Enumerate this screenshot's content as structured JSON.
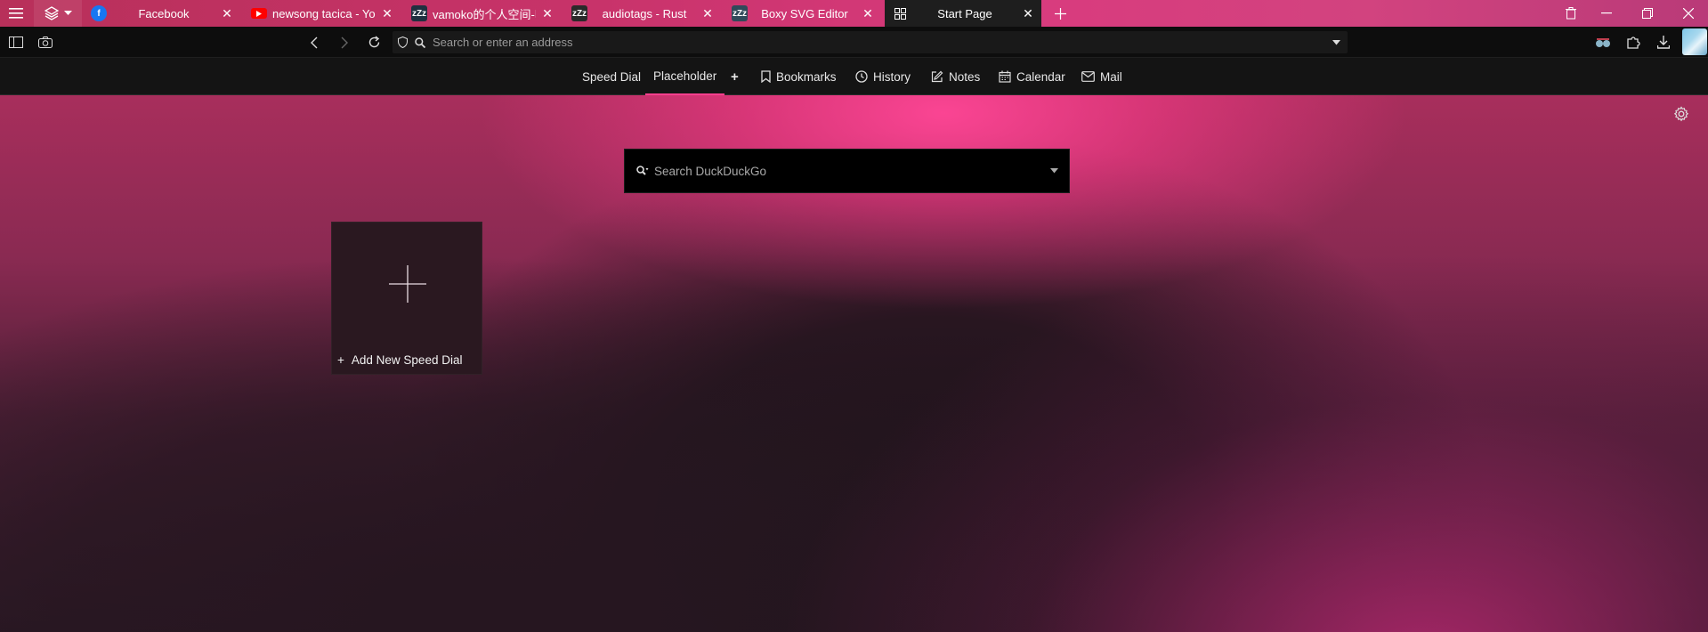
{
  "tabs": [
    {
      "title": "Facebook",
      "favicon": "facebook-icon",
      "favicon_color": "#1877f2",
      "close": "✕"
    },
    {
      "title": "newsong tacica - YouTube",
      "favicon": "youtube-icon",
      "favicon_color": "#ff0000",
      "close": "✕"
    },
    {
      "title": "vamoko的个人空间-哔哩哔哩",
      "favicon": "hibernated-tab-icon",
      "favicon_label": "zZz",
      "close": "✕"
    },
    {
      "title": "audiotags - Rust",
      "favicon": "hibernated-tab-icon",
      "favicon_label": "zZz",
      "close": "✕"
    },
    {
      "title": "Boxy SVG Editor",
      "favicon": "hibernated-tab-icon",
      "favicon_label": "zZz",
      "close": "✕"
    },
    {
      "title": "Start Page",
      "favicon": "speed-dial-grid-icon",
      "close": "✕",
      "active": true
    }
  ],
  "address_bar": {
    "placeholder": "Search or enter an address"
  },
  "start_nav": {
    "items": [
      {
        "label": "Speed Dial"
      },
      {
        "label": "Placeholder",
        "active": true
      },
      {
        "label": "+"
      },
      {
        "label": "Bookmarks",
        "icon": "bookmark-icon"
      },
      {
        "label": "History",
        "icon": "clock-icon"
      },
      {
        "label": "Notes",
        "icon": "notes-icon"
      },
      {
        "label": "Calendar",
        "icon": "calendar-icon"
      },
      {
        "label": "Mail",
        "icon": "mail-icon"
      }
    ]
  },
  "search": {
    "placeholder": "Search DuckDuckGo"
  },
  "speed_dial": {
    "add_label": "Add New Speed Dial",
    "add_prefix": "+"
  },
  "colors": {
    "accent": "#ff3f8e",
    "tab_active_bg": "#1e1e1e",
    "toolbar_bg": "#0d0d0d"
  }
}
